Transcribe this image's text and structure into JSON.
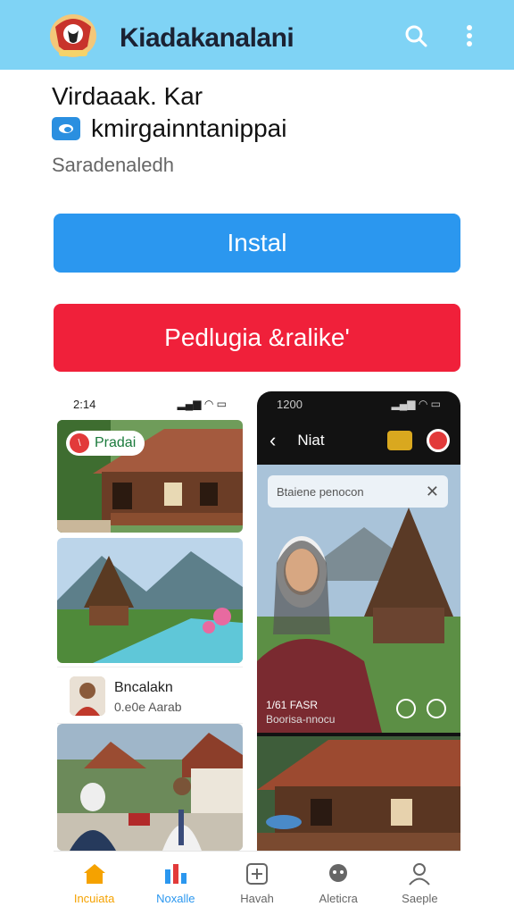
{
  "appbar": {
    "title": "Kiadakanalani",
    "search_icon": "search-icon",
    "menu_icon": "more-vert-icon",
    "bg": "#7fd3f5"
  },
  "app": {
    "name": "Virdaaak. Kar",
    "developer": "kmirgainntanippai",
    "subtext": "Saradenaledh"
  },
  "buttons": {
    "install": "Instal",
    "secondary": "Pedlugia &ralike'"
  },
  "screenshots": {
    "left": {
      "time": "2:14",
      "badge": "Pradai",
      "profile_name": "Bncalakn",
      "profile_sub": "0.e0e Aarab"
    },
    "right": {
      "time": "1200",
      "title": "Niat",
      "search_placeholder": "Btaiene penocon",
      "photo_caption_1": "1/61 FASR",
      "photo_caption_2": "Boorisa-nnocu"
    }
  },
  "nav": [
    {
      "label": "Incuiata",
      "icon": "home-icon"
    },
    {
      "label": "Noxalle",
      "icon": "chart-icon"
    },
    {
      "label": "Havah",
      "icon": "add-box-icon"
    },
    {
      "label": "Aleticra",
      "icon": "chat-icon"
    },
    {
      "label": "Saeple",
      "icon": "profile-icon"
    }
  ],
  "colors": {
    "install": "#2b97ef",
    "secondary": "#f0203a",
    "active_nav": "#f5a200"
  }
}
